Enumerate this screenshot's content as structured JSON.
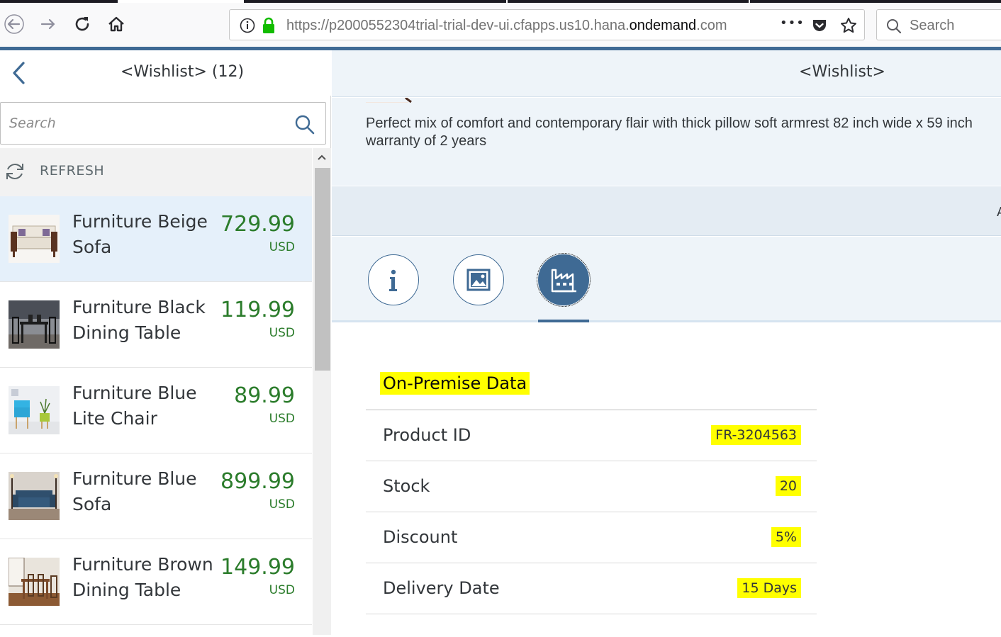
{
  "browser": {
    "url_prefix": "https://p2000552304trial-trial-dev-ui.cfapps.us10.hana.",
    "url_domain": "ondemand",
    "url_suffix": ".com",
    "search_placeholder": "Search",
    "overflow_dots": "•••"
  },
  "master": {
    "title": "<Wishlist> (12)",
    "search_placeholder": "Search",
    "refresh_label": "REFRESH",
    "items": [
      {
        "name": "Furniture Beige Sofa",
        "price": "729.99",
        "currency": "USD",
        "image": "beige-sofa"
      },
      {
        "name": "Furniture Black Dining Table",
        "price": "119.99",
        "currency": "USD",
        "image": "black-dining-table"
      },
      {
        "name": "Furniture Blue Lite Chair",
        "price": "89.99",
        "currency": "USD",
        "image": "blue-lite-chair"
      },
      {
        "name": "Furniture Blue Sofa",
        "price": "899.99",
        "currency": "USD",
        "image": "blue-sofa"
      },
      {
        "name": "Furniture Brown Dining Table",
        "price": "149.99",
        "currency": "USD",
        "image": "brown-dining-table"
      }
    ]
  },
  "detail": {
    "title": "<Wishlist>",
    "description_line1": "Perfect mix of comfort and contemporary flair with thick pillow soft armrest 82 inch wide x 59 inch",
    "description_line2": "warranty of 2 years",
    "band_text": "A",
    "tabs": [
      {
        "icon": "info-icon",
        "active": false
      },
      {
        "icon": "image-icon",
        "active": false
      },
      {
        "icon": "factory-icon",
        "active": true
      }
    ],
    "section_title": "On-Premise Data",
    "rows": [
      {
        "label": "Product ID",
        "value": "FR-3204563"
      },
      {
        "label": "Stock",
        "value": "20"
      },
      {
        "label": "Discount",
        "value": "5%"
      },
      {
        "label": "Delivery Date",
        "value": "15 Days"
      }
    ]
  },
  "colors": {
    "accent": "#3f6a94",
    "price_green": "#2b7c2b",
    "highlight": "#ffff00",
    "selected_row": "#e5f0fa"
  }
}
